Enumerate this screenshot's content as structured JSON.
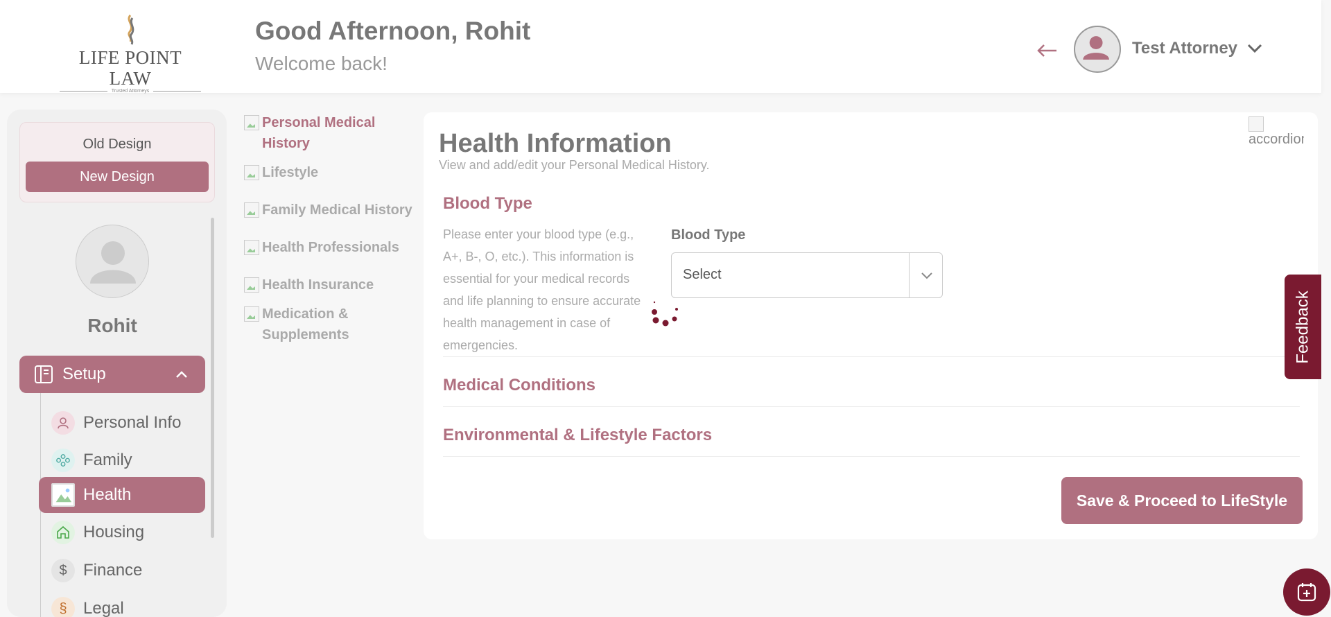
{
  "brand": {
    "name": "LIFE POINT LAW",
    "tagline": "Trusted Attorneys"
  },
  "header": {
    "greeting": "Good Afternoon, Rohit",
    "subtitle": "Welcome back!",
    "user_name": "Test Attorney"
  },
  "sidebar": {
    "old_design_label": "Old Design",
    "new_design_label": "New Design",
    "profile_name": "Rohit",
    "setup_label": "Setup",
    "items": [
      {
        "label": "Personal Info",
        "icon": "user-icon"
      },
      {
        "label": "Family",
        "icon": "family-icon"
      },
      {
        "label": "Health",
        "icon": "broken-image-icon",
        "active": true
      },
      {
        "label": "Housing",
        "icon": "home-icon"
      },
      {
        "label": "Finance",
        "icon": "dollar-icon"
      },
      {
        "label": "Legal",
        "icon": "legal-icon"
      }
    ]
  },
  "subnav": {
    "items": [
      {
        "label": "Personal Medical History",
        "active": true
      },
      {
        "label": "Lifestyle"
      },
      {
        "label": "Family Medical History"
      },
      {
        "label": "Health Professionals"
      },
      {
        "label": "Health Insurance"
      },
      {
        "label": "Medication & Supplements"
      }
    ]
  },
  "main": {
    "title": "Health Information",
    "subtitle": "View and add/edit your Personal Medical History.",
    "accordion_alt": "accordion",
    "sections": {
      "blood_type": {
        "title": "Blood Type",
        "description": "Please enter your blood type (e.g., A+, B-, O, etc.). This information is essential for your medical records and life planning to ensure accurate health management in case of emergencies.",
        "field_label": "Blood Type",
        "select_value": "Select"
      },
      "medical_conditions": {
        "title": "Medical Conditions"
      },
      "environmental": {
        "title": "Environmental & Lifestyle Factors"
      }
    },
    "save_button": "Save & Proceed to LifeStyle"
  },
  "feedback_label": "Feedback",
  "colors": {
    "accent": "#b07080",
    "dark_accent": "#7a1a30"
  }
}
